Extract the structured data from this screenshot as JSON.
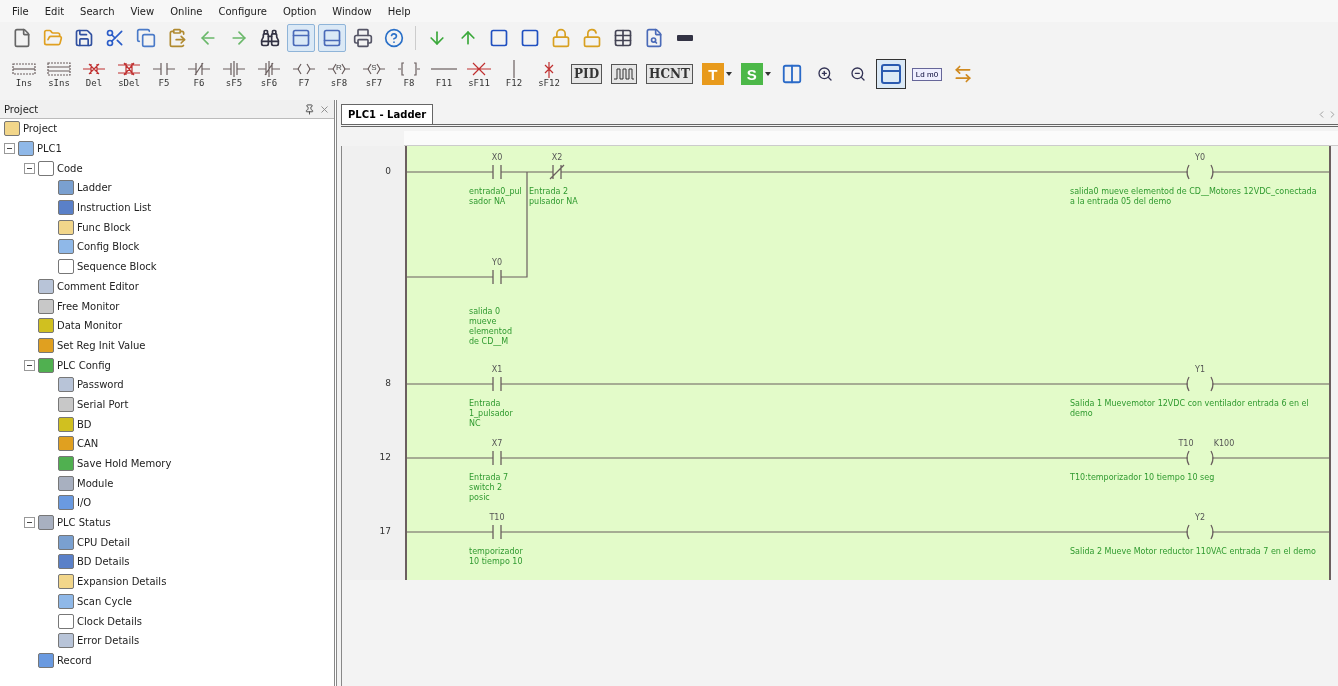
{
  "menu": [
    "File",
    "Edit",
    "Search",
    "View",
    "Online",
    "Configure",
    "Option",
    "Window",
    "Help"
  ],
  "toolbar": [
    {
      "pressed": false
    },
    {
      "pressed": false
    },
    {
      "pressed": false
    },
    {
      "pressed": false
    },
    {
      "pressed": false
    },
    {
      "pressed": false
    },
    {
      "pressed": false
    },
    {
      "pressed": false
    },
    {
      "pressed": false
    },
    {
      "pressed": true
    },
    {
      "pressed": true
    },
    {
      "pressed": false
    },
    {
      "pressed": false
    },
    {
      "pressed": false
    },
    {
      "pressed": false
    },
    {
      "pressed": false
    },
    {
      "pressed": false
    },
    {
      "pressed": false
    },
    {
      "pressed": false
    },
    {
      "pressed": false
    },
    {
      "pressed": false
    },
    {
      "pressed": false
    }
  ],
  "ladder_keys": [
    {
      "label": "Ins",
      "kind": "ins"
    },
    {
      "label": "sIns",
      "kind": "sins"
    },
    {
      "label": "Del",
      "kind": "del"
    },
    {
      "label": "sDel",
      "kind": "sdel"
    },
    {
      "label": "F5",
      "kind": "no"
    },
    {
      "label": "F6",
      "kind": "nc"
    },
    {
      "label": "sF5",
      "kind": "pno"
    },
    {
      "label": "sF6",
      "kind": "pnc"
    },
    {
      "label": "F7",
      "kind": "coil"
    },
    {
      "label": "sF8",
      "kind": "coil",
      "symbol": "R"
    },
    {
      "label": "sF7",
      "kind": "coil",
      "symbol": "S"
    },
    {
      "label": "F8",
      "kind": "func"
    },
    {
      "label": "F11",
      "kind": "hline"
    },
    {
      "label": "sF11",
      "kind": "delh"
    },
    {
      "label": "F12",
      "kind": "vline"
    },
    {
      "label": "sF12",
      "kind": "delv"
    }
  ],
  "tools": [
    {
      "kind": "text",
      "label": "PID",
      "pressed": false
    },
    {
      "kind": "wave",
      "pressed": false
    },
    {
      "kind": "text",
      "label": "HCNT",
      "pressed": false
    },
    {
      "kind": "letter",
      "label": "T",
      "color": "#e89a1c",
      "pressed": false
    },
    {
      "kind": "letter",
      "label": "S",
      "color": "#4cb848",
      "pressed": false
    },
    {
      "kind": "compare",
      "pressed": false
    },
    {
      "kind": "zoom-in",
      "pressed": false
    },
    {
      "kind": "zoom-out",
      "pressed": false
    },
    {
      "kind": "panel",
      "pressed": true
    },
    {
      "kind": "ldm",
      "label": "Ld m0",
      "pressed": false
    },
    {
      "kind": "swap",
      "pressed": false
    }
  ],
  "sidebar": {
    "title": "Project",
    "tree": [
      {
        "label": "Project",
        "children": [
          {
            "label": "PLC1",
            "expanded": true,
            "children": [
              {
                "label": "Code",
                "expanded": true,
                "children": [
                  {
                    "label": "Ladder"
                  },
                  {
                    "label": "Instruction List"
                  },
                  {
                    "label": "Func Block"
                  },
                  {
                    "label": "Config Block"
                  },
                  {
                    "label": "Sequence Block"
                  }
                ]
              },
              {
                "label": "Comment Editor"
              },
              {
                "label": "Free Monitor"
              },
              {
                "label": "Data Monitor"
              },
              {
                "label": "Set Reg Init Value"
              },
              {
                "label": "PLC Config",
                "expanded": true,
                "children": [
                  {
                    "label": "Password"
                  },
                  {
                    "label": "Serial Port"
                  },
                  {
                    "label": "BD"
                  },
                  {
                    "label": "CAN"
                  },
                  {
                    "label": "Save Hold Memory"
                  },
                  {
                    "label": "Module"
                  },
                  {
                    "label": "I/O"
                  }
                ]
              },
              {
                "label": "PLC Status",
                "expanded": true,
                "children": [
                  {
                    "label": "CPU Detail"
                  },
                  {
                    "label": "BD Details"
                  },
                  {
                    "label": "Expansion Details"
                  },
                  {
                    "label": "Scan Cycle"
                  },
                  {
                    "label": "Clock Details"
                  },
                  {
                    "label": "Error Details"
                  }
                ]
              },
              {
                "label": "Record"
              }
            ]
          }
        ]
      }
    ]
  },
  "tabs": [
    {
      "label": "PLC1 - Ladder",
      "selected": true
    }
  ],
  "rungs": [
    {
      "step": "0",
      "contacts": [
        {
          "label": "X0",
          "kind": "no",
          "comment": "entrada0_pulsador NA"
        },
        {
          "label": "X2",
          "kind": "nc",
          "comment": "Entrada 2 pulsador NA"
        }
      ],
      "branch": {
        "label": "Y0",
        "kind": "no",
        "comment": "salida 0 mueve elementod de CD__M"
      },
      "coil": {
        "label": "Y0",
        "comment": "salida0 mueve elementod de CD__Motores 12VDC_conectada a la entrada 05 del demo"
      }
    },
    {
      "step": "8",
      "contacts": [
        {
          "label": "X1",
          "kind": "no",
          "comment": "Entrada 1_pulsador NC"
        }
      ],
      "coil": {
        "label": "Y1",
        "comment": "Salida 1 Muevemotor 12VDC con ventilador entrada 6 en el demo"
      }
    },
    {
      "step": "12",
      "contacts": [
        {
          "label": "X7",
          "kind": "no",
          "comment": "Entrada 7 switch 2 posic"
        }
      ],
      "coil": {
        "label": "T10",
        "operand": "K100",
        "comment": "T10:temporizador 10 tiempo 10 seg"
      }
    },
    {
      "step": "17",
      "contacts": [
        {
          "label": "T10",
          "kind": "no",
          "comment": "temporizador 10 tiempo 10"
        }
      ],
      "coil": {
        "label": "Y2",
        "comment": "Salida 2 Mueve Motor reductor 110VAC entrada 7 en el demo"
      }
    }
  ]
}
